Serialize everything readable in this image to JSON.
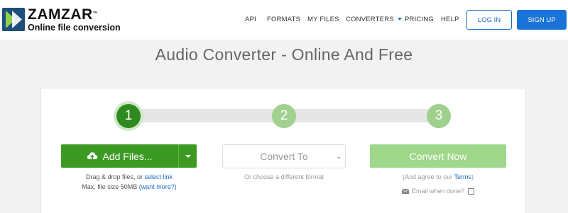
{
  "brand": {
    "name": "ZAMZAR",
    "trademark": "™",
    "tagline": "Online file conversion"
  },
  "nav": {
    "links": [
      "API",
      "FORMATS",
      "MY FILES",
      "CONVERTERS",
      "PRICING",
      "HELP"
    ],
    "login": "LOG IN",
    "signup": "SIGN UP"
  },
  "page": {
    "title": "Audio Converter - Online And Free"
  },
  "steps": [
    "1",
    "2",
    "3"
  ],
  "step1": {
    "button": "Add Files...",
    "drag_text": "Drag & drop files, or ",
    "select_link": "select link",
    "max_size": "Max. file size 50MB ",
    "want_more": "(want more?)"
  },
  "step2": {
    "select_placeholder": "Convert To",
    "sub": "Or choose a different format"
  },
  "step3": {
    "button": "Convert Now",
    "agree_prefix": "(And agree to our ",
    "terms": "Terms",
    "agree_suffix": ")",
    "email_label": "Email when done?"
  },
  "colors": {
    "accent_blue": "#1a73d6",
    "step_active": "#2e8a1f",
    "step_inactive": "#9fd08d",
    "add_files": "#3c9a23",
    "convert_now": "#9fd88a"
  }
}
